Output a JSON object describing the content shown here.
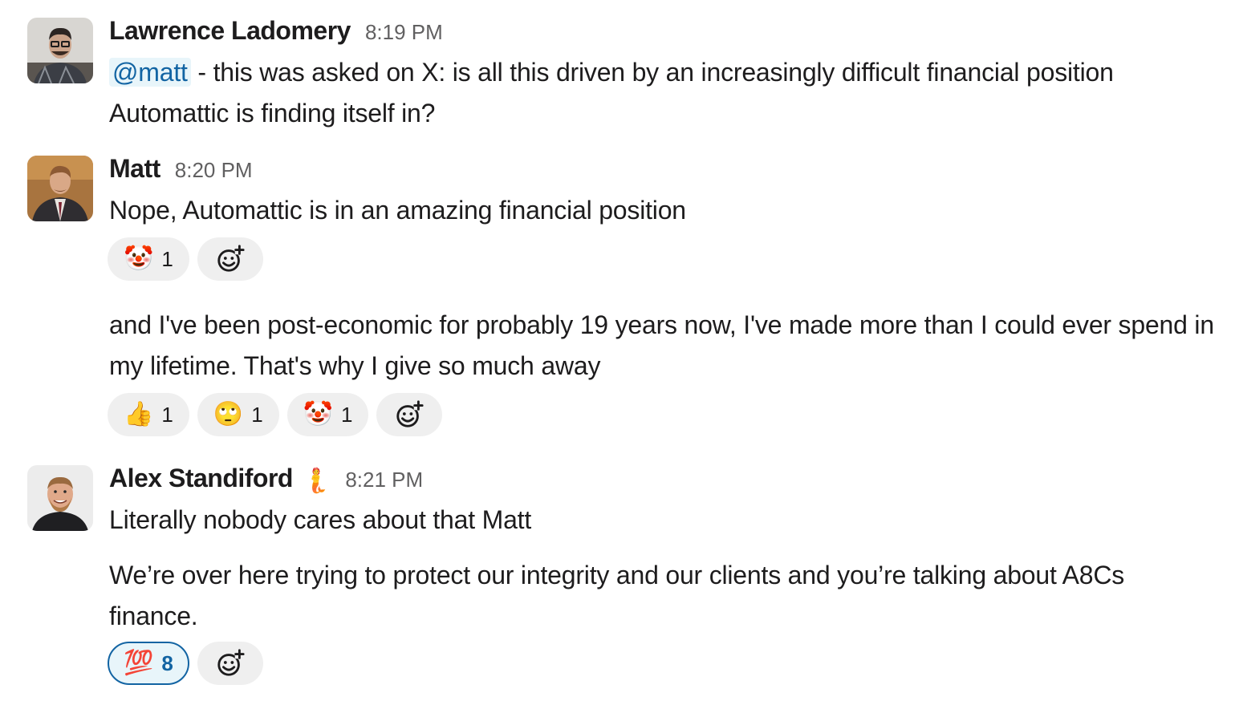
{
  "messages": [
    {
      "sender": "Lawrence Ladomery",
      "time": "8:19 PM",
      "mention": "@matt",
      "text_after_mention": " - this was asked on X: is all this driven by an increasingly difficult financial position Automattic is finding itself in?"
    },
    {
      "sender": "Matt",
      "time": "8:20 PM",
      "text": "Nope, Automattic is in an amazing financial position",
      "reactions": [
        {
          "emoji": "🤡",
          "icon": "clown-face-icon",
          "count": "1"
        }
      ],
      "followup_text": "and I've been post-economic for probably 19 years now, I've made more than I could ever spend in my lifetime. That's why I give so much away",
      "followup_reactions": [
        {
          "emoji": "👍",
          "icon": "thumbs-up-icon",
          "count": "1"
        },
        {
          "emoji": "🙄",
          "icon": "eye-roll-face-icon",
          "count": "1"
        },
        {
          "emoji": "🤡",
          "icon": "clown-face-icon",
          "count": "1"
        }
      ]
    },
    {
      "sender": "Alex Standiford",
      "status_emoji": "🧜",
      "time": "8:21 PM",
      "text": "Literally nobody cares about that Matt",
      "followup_text": "We’re over here trying to protect our integrity and our clients and you’re talking about A8Cs finance.",
      "reactions": [
        {
          "emoji": "💯",
          "icon": "hundred-points-icon",
          "count": "8",
          "active": true
        }
      ]
    }
  ],
  "colors": {
    "mention_bg": "#e8f5fa",
    "mention_text": "#1264a3",
    "reaction_bg": "#efefef",
    "active_border": "#1264a3",
    "timestamp": "#616061"
  }
}
